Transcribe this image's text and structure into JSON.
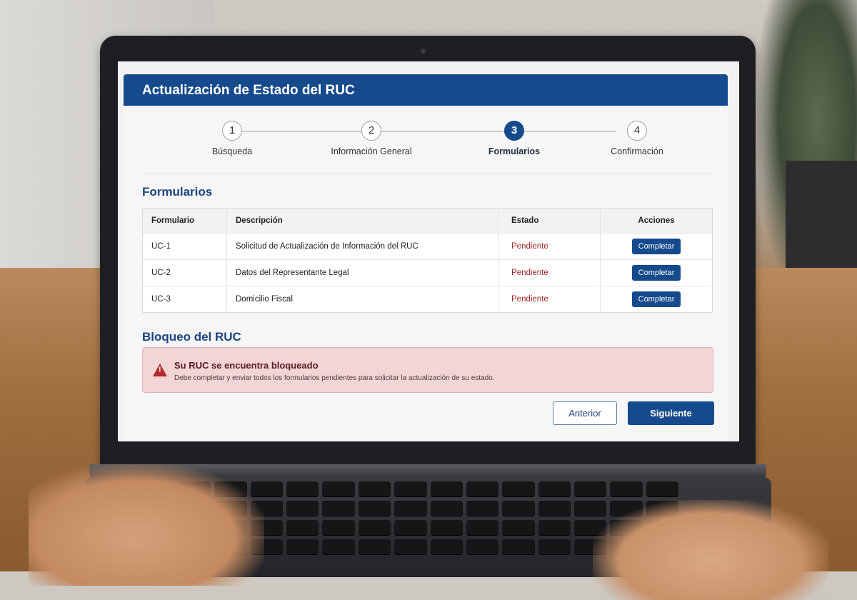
{
  "app": {
    "title": "Actualización de Estado del RUC",
    "accent_color": "#154a8c"
  },
  "stepper": {
    "current": 3,
    "steps": [
      {
        "number": "1",
        "label": "Búsqueda"
      },
      {
        "number": "2",
        "label": "Información General"
      },
      {
        "number": "3",
        "label": "Formularios"
      },
      {
        "number": "4",
        "label": "Confirmación"
      }
    ]
  },
  "forms": {
    "title": "Formularios",
    "columns": [
      "Formulario",
      "Descripción",
      "Estado",
      "Acciones"
    ],
    "rows": [
      {
        "code": "UC-1",
        "description": "Solicitud de Actualización de Información del RUC",
        "status": "Pendiente",
        "action": "Completar"
      },
      {
        "code": "UC-2",
        "description": "Datos del Representante Legal",
        "status": "Pendiente",
        "action": "Completar"
      },
      {
        "code": "UC-3",
        "description": "Domicilio Fiscal",
        "status": "Pendiente",
        "action": "Completar"
      }
    ]
  },
  "block": {
    "title": "Bloqueo del RUC",
    "alert_icon": "warning-icon",
    "alert_title": "Su RUC se encuentra bloqueado",
    "alert_text": "Debe completar y enviar todos los formularios pendientes para solicitar la actualización de su estado."
  },
  "nav": {
    "prev_label": "Anterior",
    "next_label": "Siguiente"
  }
}
